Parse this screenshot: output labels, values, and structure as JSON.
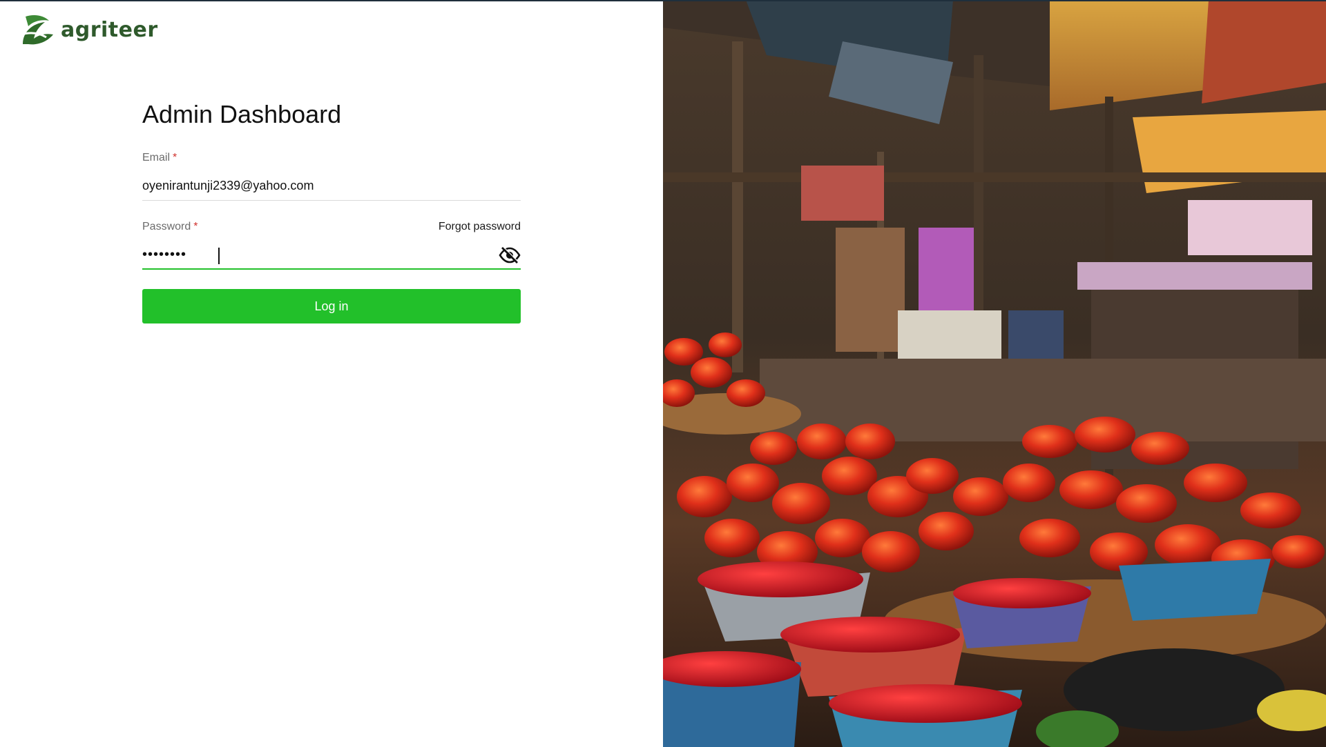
{
  "brand": {
    "name": "agriteer",
    "logo_icon": "agriteer-leaf-logo",
    "color": "#2f5a2c"
  },
  "form": {
    "title": "Admin Dashboard",
    "email_label": "Email",
    "email_required_mark": "*",
    "email_value": "oyenirantunji2339@yahoo.com",
    "password_label": "Password",
    "password_required_mark": "*",
    "password_value": "••••••••",
    "forgot_password": "Forgot password",
    "password_toggle_icon": "eye-slash-icon",
    "login_button": "Log in"
  },
  "colors": {
    "accent": "#22c02a",
    "required": "#d0312d"
  },
  "hero_image": {
    "subject": "market stall with tomatoes and peppers"
  }
}
